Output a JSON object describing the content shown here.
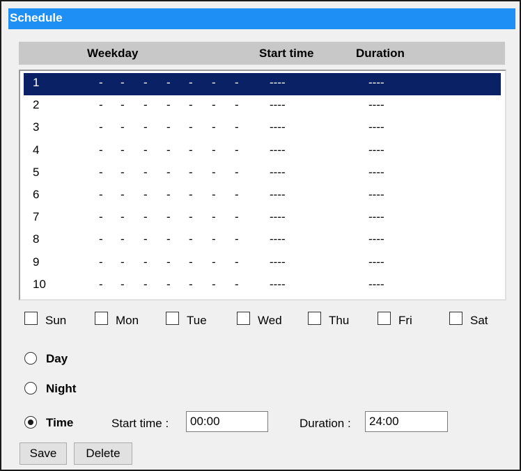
{
  "panel": {
    "title": "Schedule"
  },
  "columns": {
    "weekday": "Weekday",
    "start_time": "Start time",
    "duration": "Duration"
  },
  "schedule_rows": [
    {
      "num": "1",
      "days": "-",
      "start": "----",
      "duration": "----",
      "selected": true
    },
    {
      "num": "2",
      "days": "-",
      "start": "----",
      "duration": "----",
      "selected": false
    },
    {
      "num": "3",
      "days": "-",
      "start": "----",
      "duration": "----",
      "selected": false
    },
    {
      "num": "4",
      "days": "-",
      "start": "----",
      "duration": "----",
      "selected": false
    },
    {
      "num": "5",
      "days": "-",
      "start": "----",
      "duration": "----",
      "selected": false
    },
    {
      "num": "6",
      "days": "-",
      "start": "----",
      "duration": "----",
      "selected": false
    },
    {
      "num": "7",
      "days": "-",
      "start": "----",
      "duration": "----",
      "selected": false
    },
    {
      "num": "8",
      "days": "-",
      "start": "----",
      "duration": "----",
      "selected": false
    },
    {
      "num": "9",
      "days": "-",
      "start": "----",
      "duration": "----",
      "selected": false
    },
    {
      "num": "10",
      "days": "-",
      "start": "----",
      "duration": "----",
      "selected": false
    }
  ],
  "weekdays": [
    {
      "label": "Sun",
      "checked": false
    },
    {
      "label": "Mon",
      "checked": false
    },
    {
      "label": "Tue",
      "checked": false
    },
    {
      "label": "Wed",
      "checked": false
    },
    {
      "label": "Thu",
      "checked": false
    },
    {
      "label": "Fri",
      "checked": false
    },
    {
      "label": "Sat",
      "checked": false
    }
  ],
  "mode": {
    "day_label": "Day",
    "night_label": "Night",
    "time_label": "Time",
    "selected": "time"
  },
  "time_fields": {
    "start_label": "Start time :",
    "start_value": "00:00",
    "duration_label": "Duration :",
    "duration_value": "24:00"
  },
  "buttons": {
    "save": "Save",
    "delete": "Delete"
  },
  "colors": {
    "title_bar": "#1e8ff5",
    "selected_row": "#0a2166",
    "header_bg": "#c8c8c8"
  }
}
